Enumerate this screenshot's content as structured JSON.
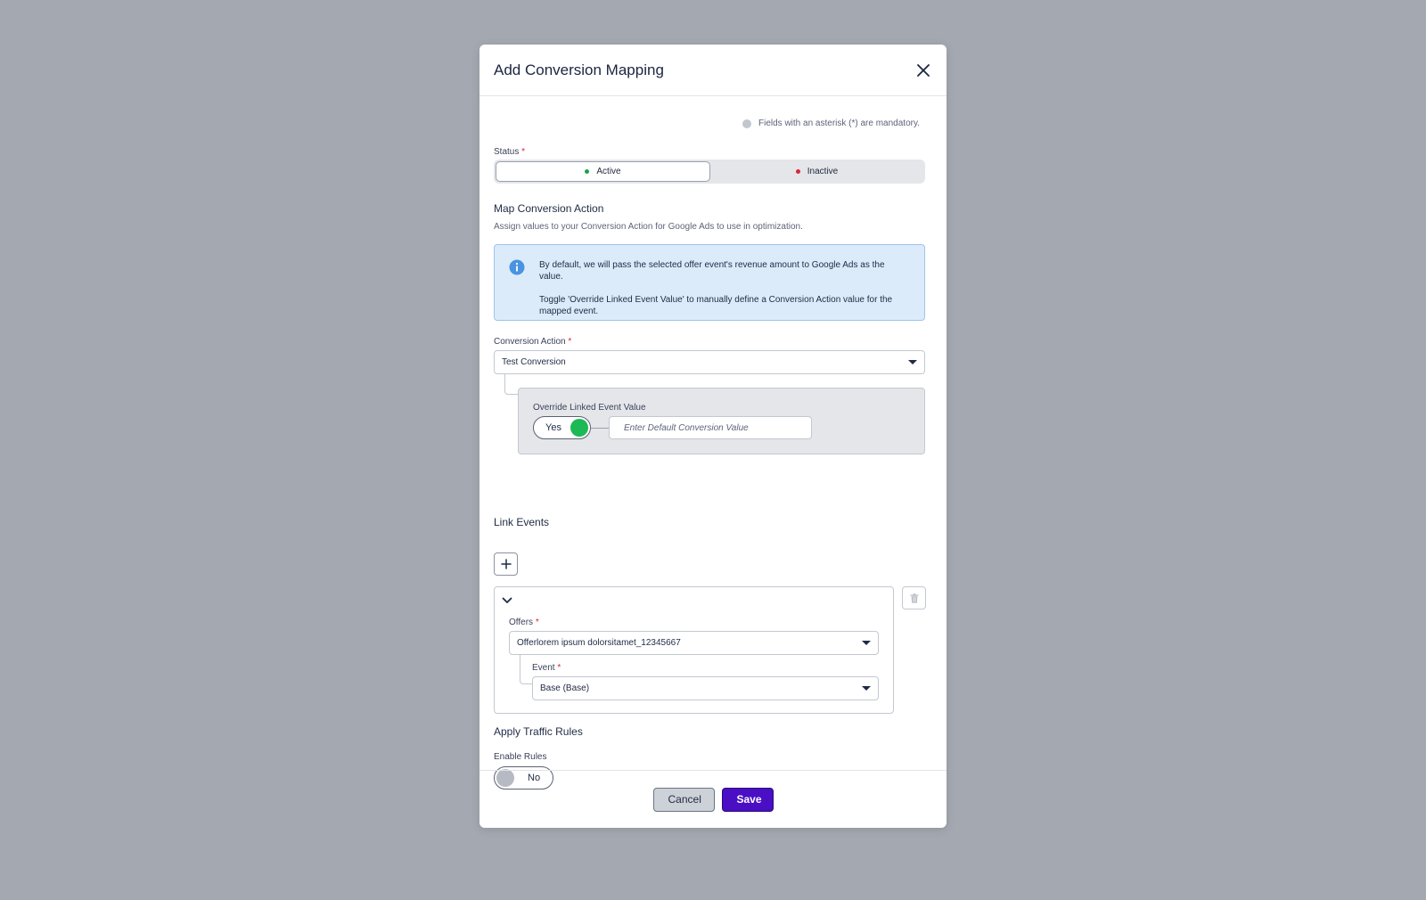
{
  "modal": {
    "title": "Add Conversion Mapping",
    "mandatory_note": "Fields with an asterisk (*) are mandatory."
  },
  "status": {
    "label": "Status",
    "required_mark": "*",
    "options": [
      {
        "label": "Active",
        "color": "#1aa34a",
        "selected": true
      },
      {
        "label": "Inactive",
        "color": "#d9253d",
        "selected": false
      }
    ]
  },
  "map_section": {
    "title": "Map Conversion Action",
    "subtitle": "Assign values to your Conversion Action for Google Ads to use in optimization.",
    "info_line1": "By default, we will pass the selected offer event's revenue amount to Google Ads as the value.",
    "info_line2": "Toggle 'Override Linked Event Value' to manually define a Conversion Action value for the mapped event."
  },
  "conversion_action": {
    "label": "Conversion Action",
    "required_mark": "*",
    "value": "Test Conversion"
  },
  "override": {
    "label": "Override Linked Event Value",
    "toggle_label": "Yes",
    "toggle_on": true,
    "toggle_color": "#1db954",
    "input_placeholder": "Enter Default Conversion Value"
  },
  "link_events": {
    "title": "Link Events",
    "offers_label": "Offers",
    "offers_required_mark": "*",
    "offers_value": "Offerlorem ipsum dolorsitamet_12345667",
    "event_label": "Event",
    "event_required_mark": "*",
    "event_value": "Base (Base)"
  },
  "traffic_rules": {
    "title": "Apply Traffic Rules",
    "enable_label": "Enable Rules",
    "toggle_label": "No",
    "toggle_on": false
  },
  "footer": {
    "cancel_label": "Cancel",
    "save_label": "Save",
    "save_color": "#4a0fc4"
  }
}
